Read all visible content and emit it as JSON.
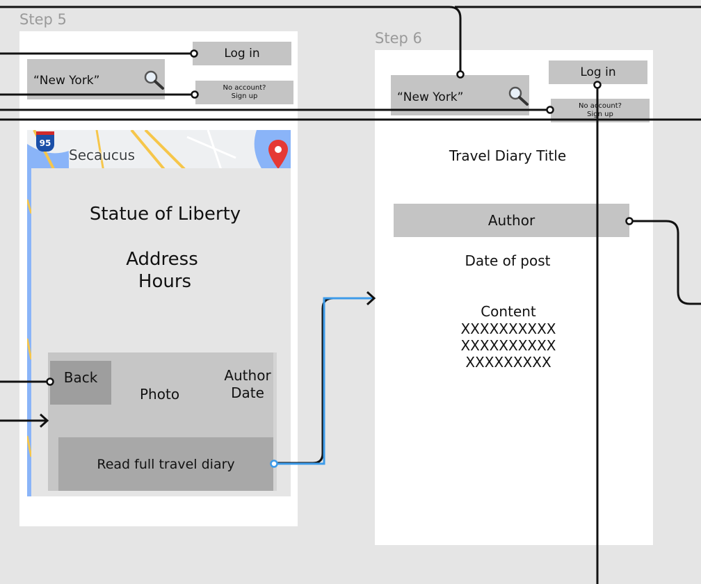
{
  "step5": {
    "label": "Step 5",
    "login": "Log in",
    "search_value": "“New York”",
    "signup_line1": "No account?",
    "signup_line2": "Sign up",
    "map_interstate": "95",
    "map_city": "Secaucus",
    "place_title": "Statue of Liberty",
    "address": "Address",
    "hours": "Hours",
    "back": "Back",
    "photo": "Photo",
    "author": "Author",
    "date": "Date",
    "read_full": "Read full travel diary"
  },
  "step6": {
    "label": "Step 6",
    "login": "Log in",
    "search_value": "“New York”",
    "signup_line1": "No account?",
    "signup_line2": "Sign up",
    "diary_title": "Travel Diary Title",
    "author": "Author",
    "date_of_post": "Date of post",
    "content_label": "Content",
    "content_lines": [
      "XXXXXXXXXX",
      "XXXXXXXXXX",
      "XXXXXXXXX"
    ]
  },
  "colors": {
    "canvas": "#e5e5e5",
    "frame": "#ffffff",
    "placeholder": "#c4c4c4",
    "connector": "#111111",
    "active_connector": "#3d9be9",
    "map_pin": "#e53935"
  }
}
